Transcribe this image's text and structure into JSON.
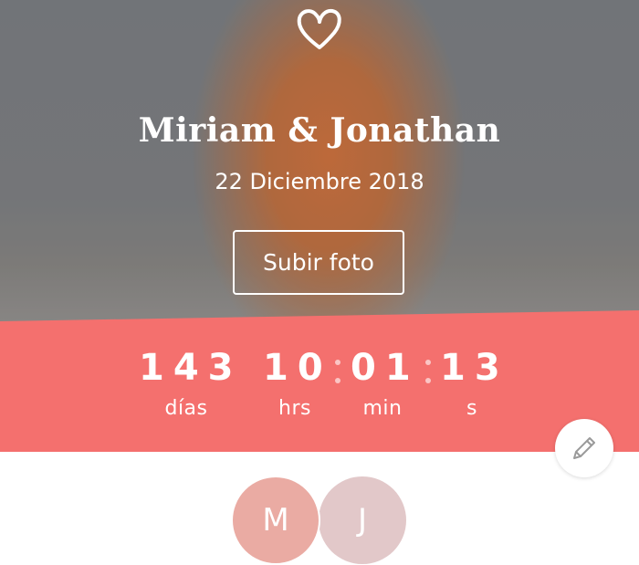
{
  "hero": {
    "names": "Miriam & Jonathan",
    "date": "22 Diciembre 2018",
    "upload_label": "Subir foto"
  },
  "countdown": {
    "days": {
      "value": "143",
      "label": "días"
    },
    "hours": {
      "value": "10",
      "label": "hrs"
    },
    "minutes": {
      "value": "01",
      "label": "min"
    },
    "seconds": {
      "value": "13",
      "label": "s"
    }
  },
  "couple": {
    "initial_1": "M",
    "initial_2": "J"
  },
  "colors": {
    "accent": "#f4706e",
    "avatar_m": "#eaaba3",
    "avatar_j": "#e2c8c9"
  },
  "icons": [
    "heart-icon",
    "pencil-icon"
  ]
}
